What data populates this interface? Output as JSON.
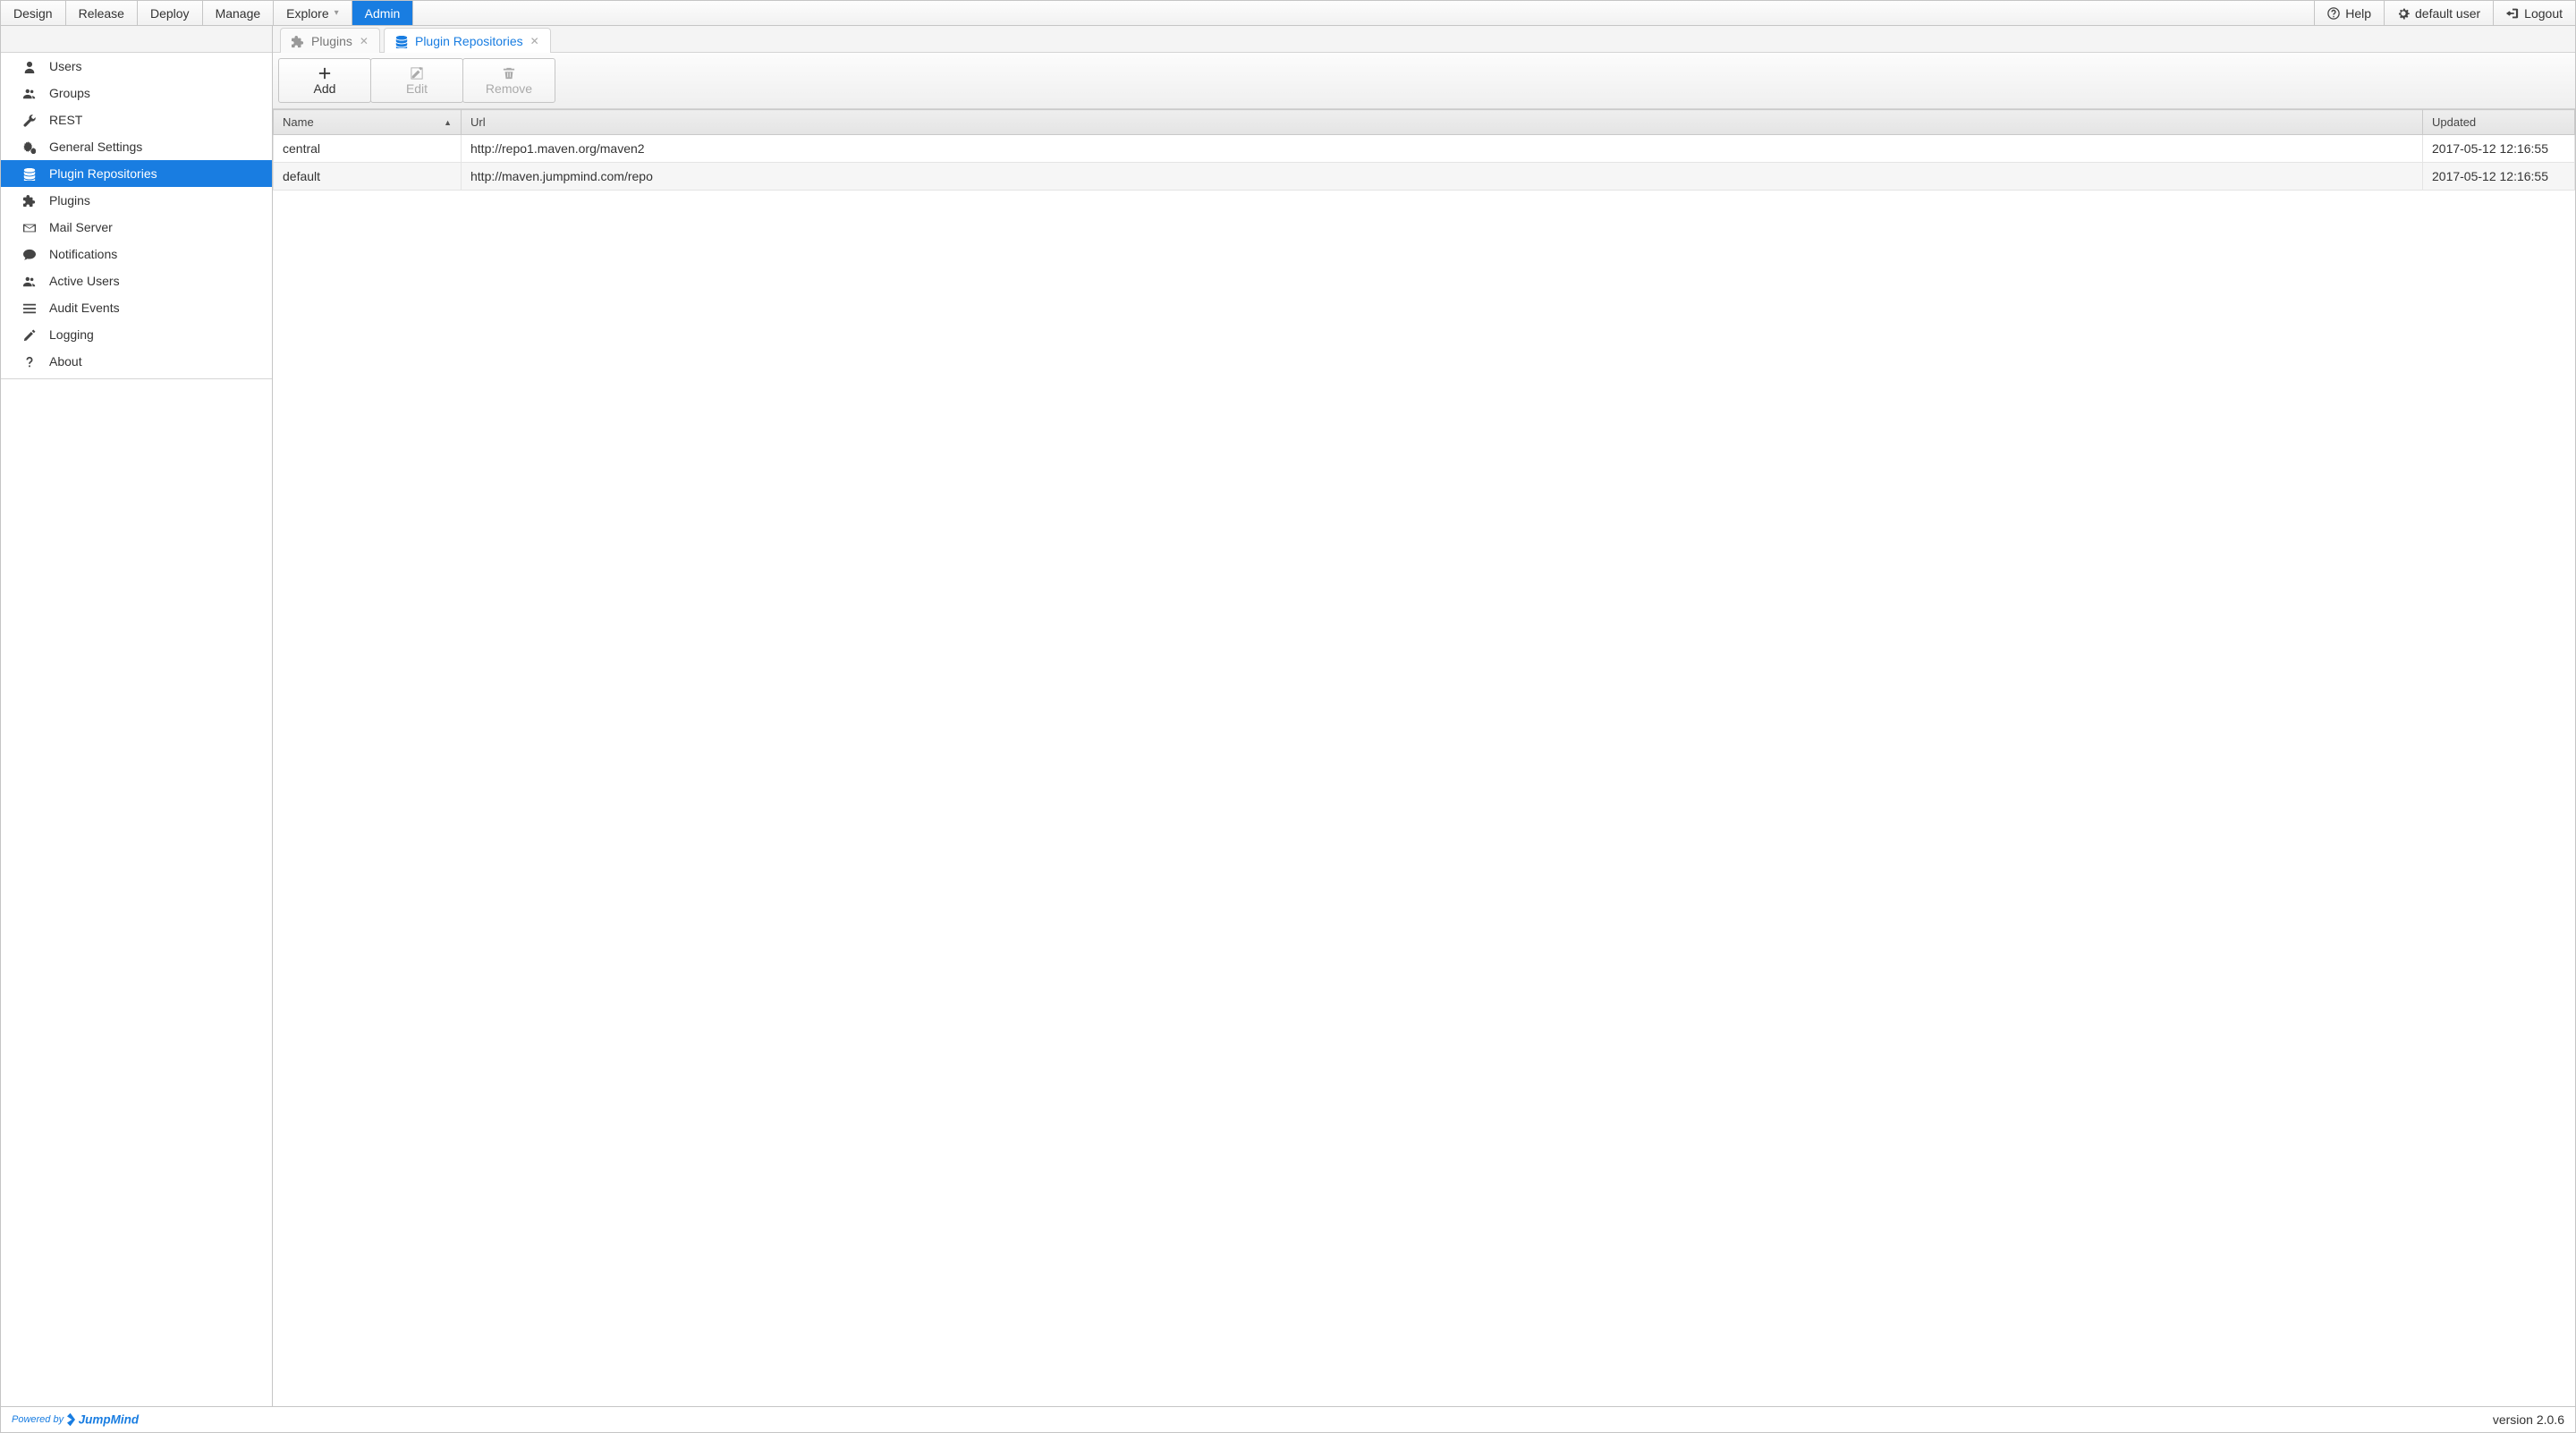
{
  "topnav": {
    "left": [
      {
        "label": "Design",
        "active": false
      },
      {
        "label": "Release",
        "active": false
      },
      {
        "label": "Deploy",
        "active": false
      },
      {
        "label": "Manage",
        "active": false
      },
      {
        "label": "Explore",
        "active": false,
        "dropdown": true
      },
      {
        "label": "Admin",
        "active": true
      }
    ],
    "right": {
      "help": "Help",
      "user": "default user",
      "logout": "Logout"
    }
  },
  "sidebar": {
    "items": [
      {
        "icon": "user",
        "label": "Users"
      },
      {
        "icon": "users",
        "label": "Groups"
      },
      {
        "icon": "wrench",
        "label": "REST"
      },
      {
        "icon": "gears",
        "label": "General Settings"
      },
      {
        "icon": "database",
        "label": "Plugin Repositories",
        "active": true
      },
      {
        "icon": "puzzle",
        "label": "Plugins"
      },
      {
        "icon": "envelope",
        "label": "Mail Server"
      },
      {
        "icon": "comment",
        "label": "Notifications"
      },
      {
        "icon": "users",
        "label": "Active Users"
      },
      {
        "icon": "list",
        "label": "Audit Events"
      },
      {
        "icon": "pencil",
        "label": "Logging"
      },
      {
        "icon": "question",
        "label": "About"
      }
    ]
  },
  "tabs": [
    {
      "icon": "puzzle",
      "label": "Plugins",
      "active": false,
      "closable": true
    },
    {
      "icon": "database",
      "label": "Plugin Repositories",
      "active": true,
      "closable": true
    }
  ],
  "toolbar": {
    "add": "Add",
    "edit": "Edit",
    "remove": "Remove"
  },
  "table": {
    "columns": {
      "name": "Name",
      "url": "Url",
      "updated": "Updated"
    },
    "sort_column": "name",
    "rows": [
      {
        "name": "central",
        "url": "http://repo1.maven.org/maven2",
        "updated": "2017-05-12 12:16:55"
      },
      {
        "name": "default",
        "url": "http://maven.jumpmind.com/repo",
        "updated": "2017-05-12 12:16:55"
      }
    ]
  },
  "footer": {
    "powered_by": "Powered by",
    "brand": "JumpMind",
    "version": "version 2.0.6"
  }
}
